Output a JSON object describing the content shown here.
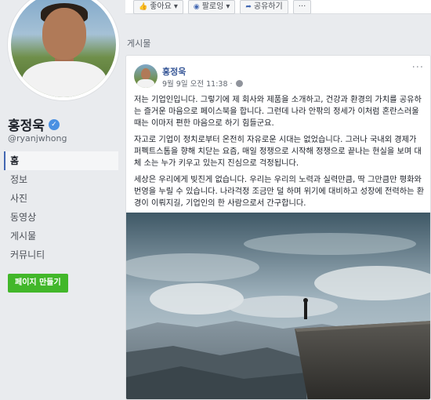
{
  "topbar": {
    "like": "좋아요",
    "follow": "팔로잉",
    "share": "공유하기",
    "more": "···"
  },
  "profile": {
    "name": "홍정욱",
    "handle": "@ryanjwhong"
  },
  "nav": {
    "items": [
      "홈",
      "정보",
      "사진",
      "동영상",
      "게시물",
      "커뮤니티"
    ],
    "active_index": 0
  },
  "create_page_label": "페이지 만들기",
  "section_label": "게시물",
  "post": {
    "author": "홍정욱",
    "time": "9월 9일 오전 11:38 ·",
    "more": "···",
    "paragraphs": [
      "저는 기업인입니다. 그렇기에 제 회사와 제품을 소개하고, 건강과 환경의 가치를 공유하는 즐거운 마음으로 페이스북을 합니다. 그런데 나라 안팎의 정세가 이처럼 혼란스러울 때는 이마저 편한 마음으로 하기 힘들군요.",
      "자고로 기업이 정치로부터 온전히 자유로운 시대는 없었습니다. 그러나 국내외 경제가 퍼펙트스톰을 향해 치닫는 요즘, 매일 정쟁으로 시작해 정쟁으로 끝나는 현실을 보며 대체 소는 누가 키우고 있는지 진심으로 걱정됩니다.",
      "세상은 우리에게 빚진게 없습니다. 우리는 우리의 노력과 실력만큼, 딱 그만큼만 평화와 번영을 누릴 수 있습니다. 나라걱정 조금만 덜 하며 위기에 대비하고 성장에 전력하는 환경이 이뤄지길, 기업인의 한 사람으로서 간구합니다."
    ]
  }
}
